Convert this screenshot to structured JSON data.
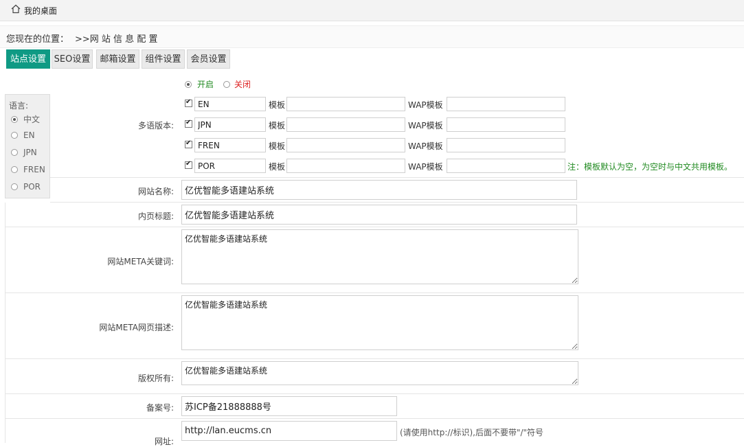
{
  "topbar": {
    "title": "我的桌面",
    "icon": "home-icon"
  },
  "location": {
    "prefix": "您现在的位置：",
    "path": ">>网 站 信 息 配 置"
  },
  "tabs": [
    {
      "label": "站点设置",
      "active": true
    },
    {
      "label": "SEO设置"
    },
    {
      "label": "邮箱设置"
    },
    {
      "label": "组件设置"
    },
    {
      "label": "会员设置"
    }
  ],
  "languages": {
    "title": "语言:",
    "items": [
      {
        "label": "中文",
        "selected": true
      },
      {
        "label": "EN"
      },
      {
        "label": "JPN"
      },
      {
        "label": "FREN"
      },
      {
        "label": "POR"
      }
    ]
  },
  "multilang": {
    "label": "多语版本:",
    "on_label": "开启",
    "off_label": "关闭",
    "template_label": "模板",
    "wap_label": "WAP模板",
    "rows": [
      {
        "code": "EN",
        "checked": true
      },
      {
        "code": "JPN",
        "checked": true
      },
      {
        "code": "FREN",
        "checked": true
      },
      {
        "code": "POR",
        "checked": true
      }
    ],
    "note": "注：模板默认为空，为空时与中文共用模板。"
  },
  "fields": {
    "site_name": {
      "label": "网站名称:",
      "value": "亿优智能多语建站系统"
    },
    "inner_title": {
      "label": "内页标题:",
      "value": "亿优智能多语建站系统"
    },
    "meta_keywords": {
      "label": "网站META关键词:",
      "value": "亿优智能多语建站系统"
    },
    "meta_desc": {
      "label": "网站META网页描述:",
      "value": "亿优智能多语建站系统"
    },
    "copyright": {
      "label": "版权所有:",
      "value": "亿优智能多语建站系统"
    },
    "icp": {
      "label": "备案号:",
      "value": "苏ICP备21888888号"
    },
    "url": {
      "label": "网址:",
      "value": "http://lan.eucms.cn",
      "hint": "(请使用http://标识),后面不要带\"/\"符号"
    }
  },
  "colors": {
    "accent": "#0f9a84",
    "note_green": "#228b22",
    "off_red": "#dd2222"
  }
}
